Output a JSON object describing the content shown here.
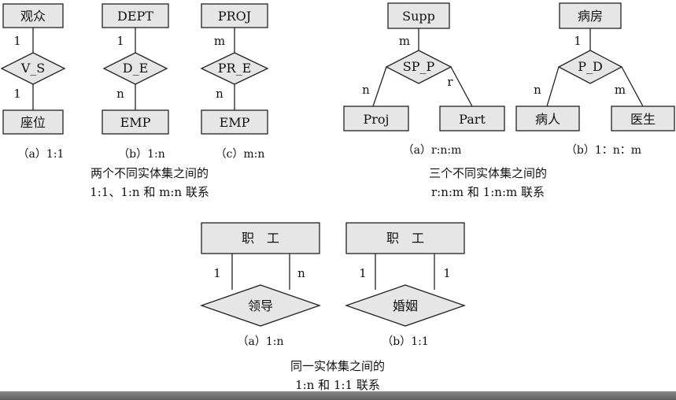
{
  "diagrams": {
    "binary": {
      "a": {
        "entity_top": "观众",
        "relation": "V_S",
        "entity_bottom": "座位",
        "card_top": "1",
        "card_bottom": "1",
        "caption": "（a）1:1"
      },
      "b": {
        "entity_top": "DEPT",
        "relation": "D_E",
        "entity_bottom": "EMP",
        "card_top": "1",
        "card_bottom": "n",
        "caption": "（b）1:n"
      },
      "c": {
        "entity_top": "PROJ",
        "relation": "PR_E",
        "entity_bottom": "EMP",
        "card_top": "m",
        "card_bottom": "n",
        "caption": "（c）m:n"
      },
      "desc_line1": "两个不同实体集之间的",
      "desc_line2": "1:1、1:n 和 m:n 联系"
    },
    "ternary": {
      "a": {
        "entity_top": "Supp",
        "relation": "SP_P",
        "entity_left": "Proj",
        "entity_right": "Part",
        "card_top": "m",
        "card_left": "n",
        "card_right": "r",
        "caption": "（a）r:n:m"
      },
      "b": {
        "entity_top": "病房",
        "relation": "P_D",
        "entity_left": "病人",
        "entity_right": "医生",
        "card_top": "1",
        "card_left": "n",
        "card_right": "m",
        "caption": "（b）1：n：m"
      },
      "desc_line1": "三个不同实体集之间的",
      "desc_line2": "r:n:m 和 1:n:m 联系"
    },
    "unary": {
      "a": {
        "entity": "职　工",
        "relation": "领导",
        "card_left": "1",
        "card_right": "n",
        "caption": "（a）1:n"
      },
      "b": {
        "entity": "职　工",
        "relation": "婚姻",
        "card_left": "1",
        "card_right": "1",
        "caption": "（b）1:1"
      },
      "desc_line1": "同一实体集之间的",
      "desc_line2": "1:n 和 1:1 联系"
    }
  }
}
